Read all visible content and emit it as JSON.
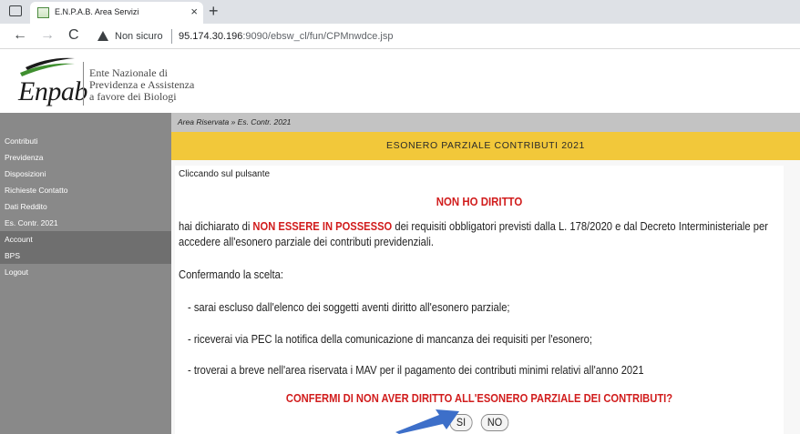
{
  "browser": {
    "tab_title": "E.N.P.A.B. Area Servizi",
    "tab_close": "×",
    "new_tab": "+",
    "back": "←",
    "forward": "→",
    "reload": "C",
    "security_label": "Non sicuro",
    "url_host": "95.174.30.196",
    "url_rest": ":9090/ebsw_cl/fun/CPMnwdce.jsp"
  },
  "header": {
    "logo_word": "Enpab",
    "logo_line1": "Ente Nazionale di",
    "logo_line2": "Previdenza e Assistenza",
    "logo_line3": "a favore dei Biologi",
    "brand_green": "#3f8f2f",
    "brand_dark": "#1a1a1a"
  },
  "sidebar": {
    "items": [
      {
        "label": "Contributi"
      },
      {
        "label": "Previdenza"
      },
      {
        "label": "Disposizioni"
      },
      {
        "label": "Richieste Contatto"
      },
      {
        "label": "Dati Reddito"
      },
      {
        "label": "Es. Contr. 2021"
      },
      {
        "label": "Account"
      },
      {
        "label": "BPS"
      },
      {
        "label": "Logout"
      }
    ]
  },
  "main": {
    "breadcrumb": "Area Riservata » Es. Contr. 2021",
    "title": "ESONERO PARZIALE CONTRIBUTI 2021",
    "intro": "Cliccando sul pulsante",
    "heading": "NON HO DIRITTO",
    "body_pre": "hai dichiarato di ",
    "body_highlight": "NON ESSERE IN POSSESSO",
    "body_post": " dei requisiti obbligatori previsti dalla L. 178/2020 e dal Decreto Interministeriale per accedere all'esonero parziale dei contributi previdenziali.",
    "confirm_intro": "Confermando la scelta:",
    "bullets": [
      "- sarai escluso dall'elenco dei soggetti aventi diritto all'esonero parziale;",
      "- riceverai via PEC la notifica della comunicazione di mancanza dei requisiti per l'esonero;",
      "- troverai a breve nell'area riservata i MAV per il pagamento dei contributi minimi relativi all'anno 2021"
    ],
    "question": "CONFERMI DI NON AVER DIRITTO ALL'ESONERO PARZIALE DEI CONTRIBUTI?",
    "btn_yes": "SI",
    "btn_no": "NO"
  },
  "colors": {
    "accent_yellow": "#f2c83a",
    "alert_red": "#d11d1d",
    "sidebar_gray": "#898989",
    "arrow_blue": "#3d6fc9"
  }
}
